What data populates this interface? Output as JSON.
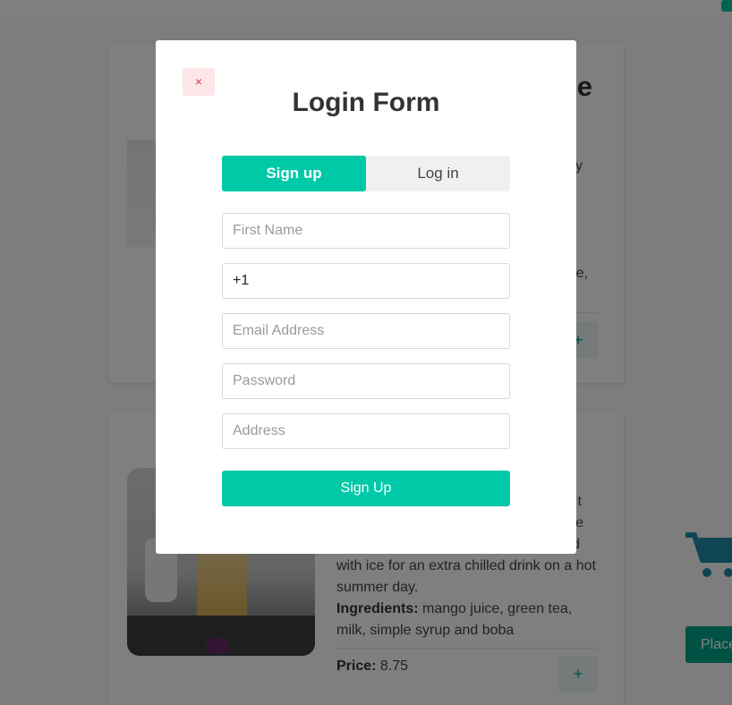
{
  "page": {
    "card_1": {
      "title_fragment": "e",
      "desc_fragment_1": "y",
      "desc_fragment_2": "e,",
      "add_label": "+"
    },
    "card_2": {
      "desc_fragment_1": "t",
      "desc_fragment_2": "e",
      "desc_fragment_3": "d",
      "description_tail": "with ice for an extra chilled drink on a hot summer day.",
      "ingredients_label": "Ingredients:",
      "ingredients": "mango juice, green tea, milk, simple syrup and boba",
      "price_label": "Price:",
      "price": "8.75",
      "add_label": "+"
    },
    "place_order_label": "Place"
  },
  "modal": {
    "close_label": "×",
    "title": "Login Form",
    "tabs": [
      {
        "label": "Sign up",
        "active": true
      },
      {
        "label": "Log in",
        "active": false
      }
    ],
    "fields": {
      "first_name": {
        "placeholder": "First Name",
        "value": ""
      },
      "phone": {
        "placeholder": "",
        "value": "+1"
      },
      "email": {
        "placeholder": "Email Address",
        "value": ""
      },
      "password": {
        "placeholder": "Password",
        "value": ""
      },
      "address": {
        "placeholder": "Address",
        "value": ""
      }
    },
    "submit_label": "Sign Up"
  },
  "colors": {
    "accent": "#00c9a7",
    "accent_dark": "#00a58a",
    "close_bg": "#fde6e8",
    "close_fg": "#e0384f",
    "cart": "#1f8aa8"
  },
  "icons": {
    "cart": "shopping-cart-icon",
    "close": "close-icon"
  }
}
